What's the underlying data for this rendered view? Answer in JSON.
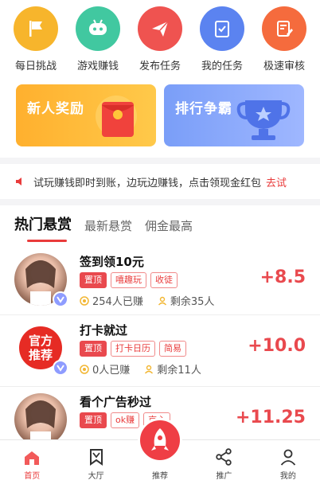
{
  "quick": [
    {
      "label": "每日挑战",
      "icon": "flag-icon",
      "color": "#f7b52c"
    },
    {
      "label": "游戏赚钱",
      "icon": "gamepad-icon",
      "color": "#41c8a0"
    },
    {
      "label": "发布任务",
      "icon": "paper-plane-icon",
      "color": "#ef5350"
    },
    {
      "label": "我的任务",
      "icon": "checklist-icon",
      "color": "#5b83f0"
    },
    {
      "label": "极速审核",
      "icon": "edit-doc-icon",
      "color": "#f56b3d"
    }
  ],
  "banners": {
    "newbie": {
      "title": "新人奖励"
    },
    "ranking": {
      "title": "排行争霸"
    }
  },
  "notice": {
    "text": "试玩赚钱即时到账，边玩边赚钱，点击领现金红包",
    "highlight": "去试"
  },
  "tabs": [
    "热门悬赏",
    "最新悬赏",
    "佣金最高"
  ],
  "tasks": [
    {
      "title": "签到领10元",
      "tags": [
        "置顶",
        "嘻趣玩",
        "收徒"
      ],
      "earned": "254人已赚",
      "remaining": "剩余35人",
      "reward": "+8.5"
    },
    {
      "title": "打卡就过",
      "avatar_text": [
        "官方",
        "推荐"
      ],
      "tags": [
        "置顶",
        "打卡日历",
        "简易"
      ],
      "earned": "0人已赚",
      "remaining": "剩余11人",
      "reward": "+10.0"
    },
    {
      "title": "看个广告秒过",
      "tags": [
        "置顶",
        "ok赚",
        "京心"
      ],
      "earned": "",
      "remaining": "",
      "reward": "+11.25"
    }
  ],
  "bottom_nav": [
    {
      "label": "首页",
      "icon": "home-icon"
    },
    {
      "label": "大厅",
      "icon": "bookmark-icon"
    },
    {
      "label": "推荐",
      "icon": "rocket-icon"
    },
    {
      "label": "推广",
      "icon": "share-icon"
    },
    {
      "label": "我的",
      "icon": "user-icon"
    }
  ],
  "colors": {
    "accent": "#e93b3b"
  }
}
